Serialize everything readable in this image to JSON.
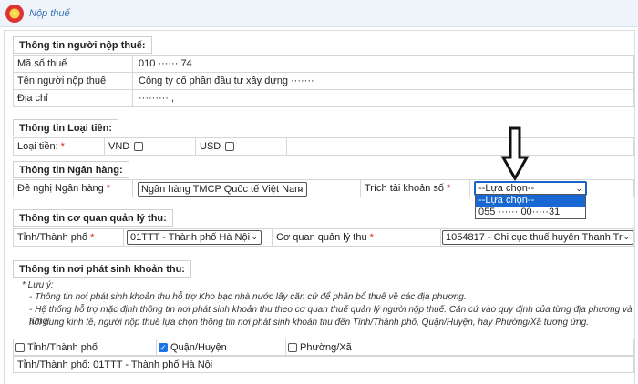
{
  "header": {
    "title": "Nộp thuế"
  },
  "taxpayer": {
    "section_title": "Thông tin người nộp thuế:",
    "tax_code_label": "Mã số thuế",
    "tax_code_value": "010  ······  74",
    "name_label": "Tên người nộp thuế",
    "name_value": "Công ty cổ phần đầu tư xây dựng  ·······",
    "address_label": "Địa chỉ",
    "address_value": "·········                              ,"
  },
  "currency": {
    "section_title": "Thông tin Loại tiền:",
    "label": "Loại tiền:",
    "required": "*",
    "vnd_label": "VND",
    "usd_label": "USD"
  },
  "bank": {
    "section_title": "Thông tin Ngân hàng:",
    "bank_label": "Đề nghị Ngân hàng",
    "required": "*",
    "bank_value": "Ngân hàng TMCP Quốc tế Việt Nam",
    "account_label": "Trích tài khoản số",
    "account_value": "--Lựa chọn--",
    "dropdown_options": [
      "--Lựa chọn--",
      "055  ······ 00·····31"
    ]
  },
  "authority": {
    "section_title": "Thông tin cơ quan quản lý thu:",
    "province_label": "Tỉnh/Thành phố",
    "province_value": "01TTT - Thành phố Hà Nội",
    "agency_label": "Cơ quan quản lý thu",
    "agency_value": "1054817 - Chi cục thuế huyện Thanh Tr",
    "required": "*"
  },
  "origin": {
    "section_title": "Thông tin nơi phát sinh khoản thu:",
    "note_label": "* Lưu ý:",
    "note_1": "- Thông tin nơi phát sinh khoản thu hỗ trợ Kho bạc nhà nước lấy căn cứ để phân bổ thuế về các địa phương.",
    "note_2": "- Hệ thống hỗ trợ mặc định thông tin nơi phát sinh khoản thu theo cơ quan thuế quản lý người nộp thuế. Căn cứ vào quy định của từng địa phương và từng",
    "note_3": "nội dung kinh tế, người nộp thuế lựa chọn thông tin nơi phát sinh khoản thu đến Tỉnh/Thành phố, Quận/Huyện, hay Phường/Xã tương ứng.",
    "opt_province": "Tỉnh/Thành phố",
    "opt_district": "Quận/Huyện",
    "opt_ward": "Phường/Xã",
    "province_line": "Tỉnh/Thành phố: 01TTT - Thành phố Hà Nội"
  }
}
